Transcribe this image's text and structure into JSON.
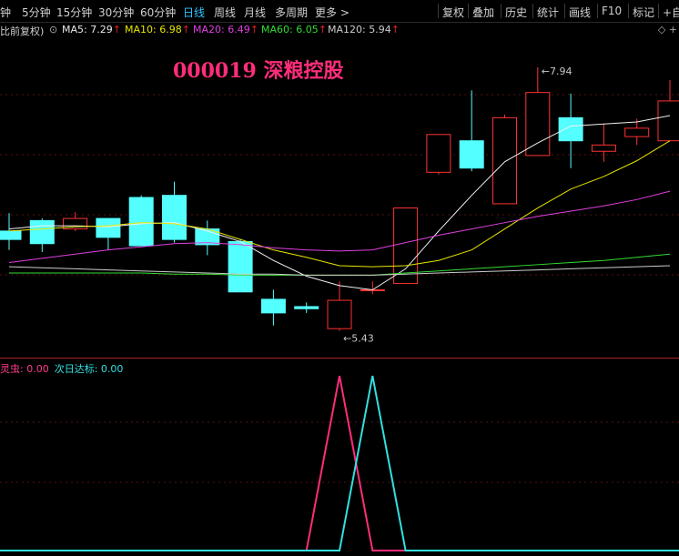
{
  "toolbar": {
    "periods": [
      "钟",
      "5分钟",
      "15分钟",
      "30分钟",
      "60分钟",
      "日线",
      "周线",
      "月线",
      "多周期",
      "更多 >"
    ],
    "active_period": "日线",
    "right_buttons": [
      "复权",
      "叠加",
      "历史",
      "统计",
      "画线",
      "F10",
      "标记",
      "+自"
    ]
  },
  "ma_legend": {
    "adjust_label": "比前复权)",
    "items": [
      {
        "label": "MA5: 7.29",
        "color": "#e8e8e8"
      },
      {
        "label": "MA10: 6.98",
        "color": "#e6e600"
      },
      {
        "label": "MA20: 6.49",
        "color": "#e040e0"
      },
      {
        "label": "MA60: 6.05",
        "color": "#33dd33"
      },
      {
        "label": "MA120: 5.94",
        "color": "#cccccc"
      }
    ],
    "arrow": "↑"
  },
  "stock_title": "000019 深粮控股",
  "indicator_legend": [
    {
      "label": "灵虫: 0.00",
      "color": "#ff3c8c"
    },
    {
      "label": "次日达标: 0.00",
      "color": "#33e0e0"
    }
  ],
  "chart_data": {
    "type": "candlestick",
    "price_range": [
      5.2,
      8.2
    ],
    "annotations": {
      "high_label": "7.94",
      "low_label": "5.43"
    },
    "candles": [
      {
        "o": 6.38,
        "c": 6.3,
        "h": 6.55,
        "l": 6.2
      },
      {
        "o": 6.48,
        "c": 6.26,
        "h": 6.5,
        "l": 6.18
      },
      {
        "o": 6.4,
        "c": 6.5,
        "h": 6.56,
        "l": 6.38
      },
      {
        "o": 6.5,
        "c": 6.32,
        "h": 6.5,
        "l": 6.2
      },
      {
        "o": 6.7,
        "c": 6.24,
        "h": 6.72,
        "l": 6.24
      },
      {
        "o": 6.72,
        "c": 6.3,
        "h": 6.85,
        "l": 6.27
      },
      {
        "o": 6.4,
        "c": 6.25,
        "h": 6.48,
        "l": 6.15
      },
      {
        "o": 6.28,
        "c": 5.8,
        "h": 6.3,
        "l": 5.8
      },
      {
        "o": 5.73,
        "c": 5.6,
        "h": 5.82,
        "l": 5.48
      },
      {
        "o": 5.66,
        "c": 5.64,
        "h": 5.7,
        "l": 5.6
      },
      {
        "o": 5.45,
        "c": 5.72,
        "h": 5.9,
        "l": 5.43
      },
      {
        "o": 5.82,
        "c": 5.82,
        "h": 5.9,
        "l": 5.78
      },
      {
        "o": 5.88,
        "c": 6.6,
        "h": 6.6,
        "l": 5.88
      },
      {
        "o": 6.94,
        "c": 7.3,
        "h": 7.3,
        "l": 6.92
      },
      {
        "o": 7.24,
        "c": 6.98,
        "h": 7.72,
        "l": 6.95
      },
      {
        "o": 6.64,
        "c": 7.46,
        "h": 7.49,
        "l": 6.64
      },
      {
        "o": 7.1,
        "c": 7.7,
        "h": 7.94,
        "l": 7.1
      },
      {
        "o": 7.46,
        "c": 7.24,
        "h": 7.69,
        "l": 6.98
      },
      {
        "o": 7.14,
        "c": 7.2,
        "h": 7.4,
        "l": 7.04
      },
      {
        "o": 7.28,
        "c": 7.36,
        "h": 7.45,
        "l": 7.2
      },
      {
        "o": 7.24,
        "c": 7.62,
        "h": 7.82,
        "l": 7.24
      }
    ],
    "ma_lines": [
      {
        "name": "MA5",
        "color": "#f0f0f0",
        "values": [
          6.4,
          6.43,
          6.43,
          6.42,
          6.45,
          6.46,
          6.38,
          6.28,
          6.1,
          5.95,
          5.86,
          5.82,
          6.02,
          6.38,
          6.72,
          7.04,
          7.22,
          7.38,
          7.4,
          7.42,
          7.48
        ]
      },
      {
        "name": "MA10",
        "color": "#e6e600",
        "values": [
          6.38,
          6.4,
          6.42,
          6.43,
          6.46,
          6.45,
          6.4,
          6.3,
          6.2,
          6.13,
          6.05,
          6.04,
          6.05,
          6.1,
          6.2,
          6.4,
          6.6,
          6.78,
          6.9,
          7.05,
          7.24
        ]
      },
      {
        "name": "MA20",
        "color": "#e040e0",
        "values": [
          6.08,
          6.12,
          6.16,
          6.2,
          6.23,
          6.26,
          6.27,
          6.25,
          6.22,
          6.2,
          6.19,
          6.2,
          6.27,
          6.34,
          6.4,
          6.46,
          6.52,
          6.57,
          6.62,
          6.68,
          6.76
        ]
      },
      {
        "name": "MA60",
        "color": "#33dd33",
        "values": [
          5.98,
          5.98,
          5.98,
          5.98,
          5.98,
          5.97,
          5.97,
          5.96,
          5.96,
          5.96,
          5.96,
          5.96,
          5.98,
          6.0,
          6.02,
          6.04,
          6.06,
          6.08,
          6.1,
          6.13,
          6.16
        ]
      },
      {
        "name": "MA120",
        "color": "#cccccc",
        "values": [
          6.04,
          6.03,
          6.02,
          6.01,
          6.0,
          5.99,
          5.98,
          5.97,
          5.97,
          5.96,
          5.96,
          5.96,
          5.97,
          5.98,
          5.99,
          6.0,
          6.01,
          6.02,
          6.03,
          6.04,
          6.05
        ]
      }
    ],
    "indicator": {
      "range": [
        0,
        1
      ],
      "series": [
        {
          "name": "灵虫",
          "color": "#ff2d7a",
          "peak_index": 10,
          "values": [
            0,
            0,
            0,
            0,
            0,
            0,
            0,
            0,
            0,
            0,
            1,
            0,
            0,
            0,
            0,
            0,
            0,
            0,
            0,
            0,
            0
          ]
        },
        {
          "name": "次日达标",
          "color": "#33e0e0",
          "peak_index": 11,
          "values": [
            0,
            0,
            0,
            0,
            0,
            0,
            0,
            0,
            0,
            0,
            0,
            1,
            0,
            0,
            0,
            0,
            0,
            0,
            0,
            0,
            0
          ]
        }
      ]
    }
  }
}
